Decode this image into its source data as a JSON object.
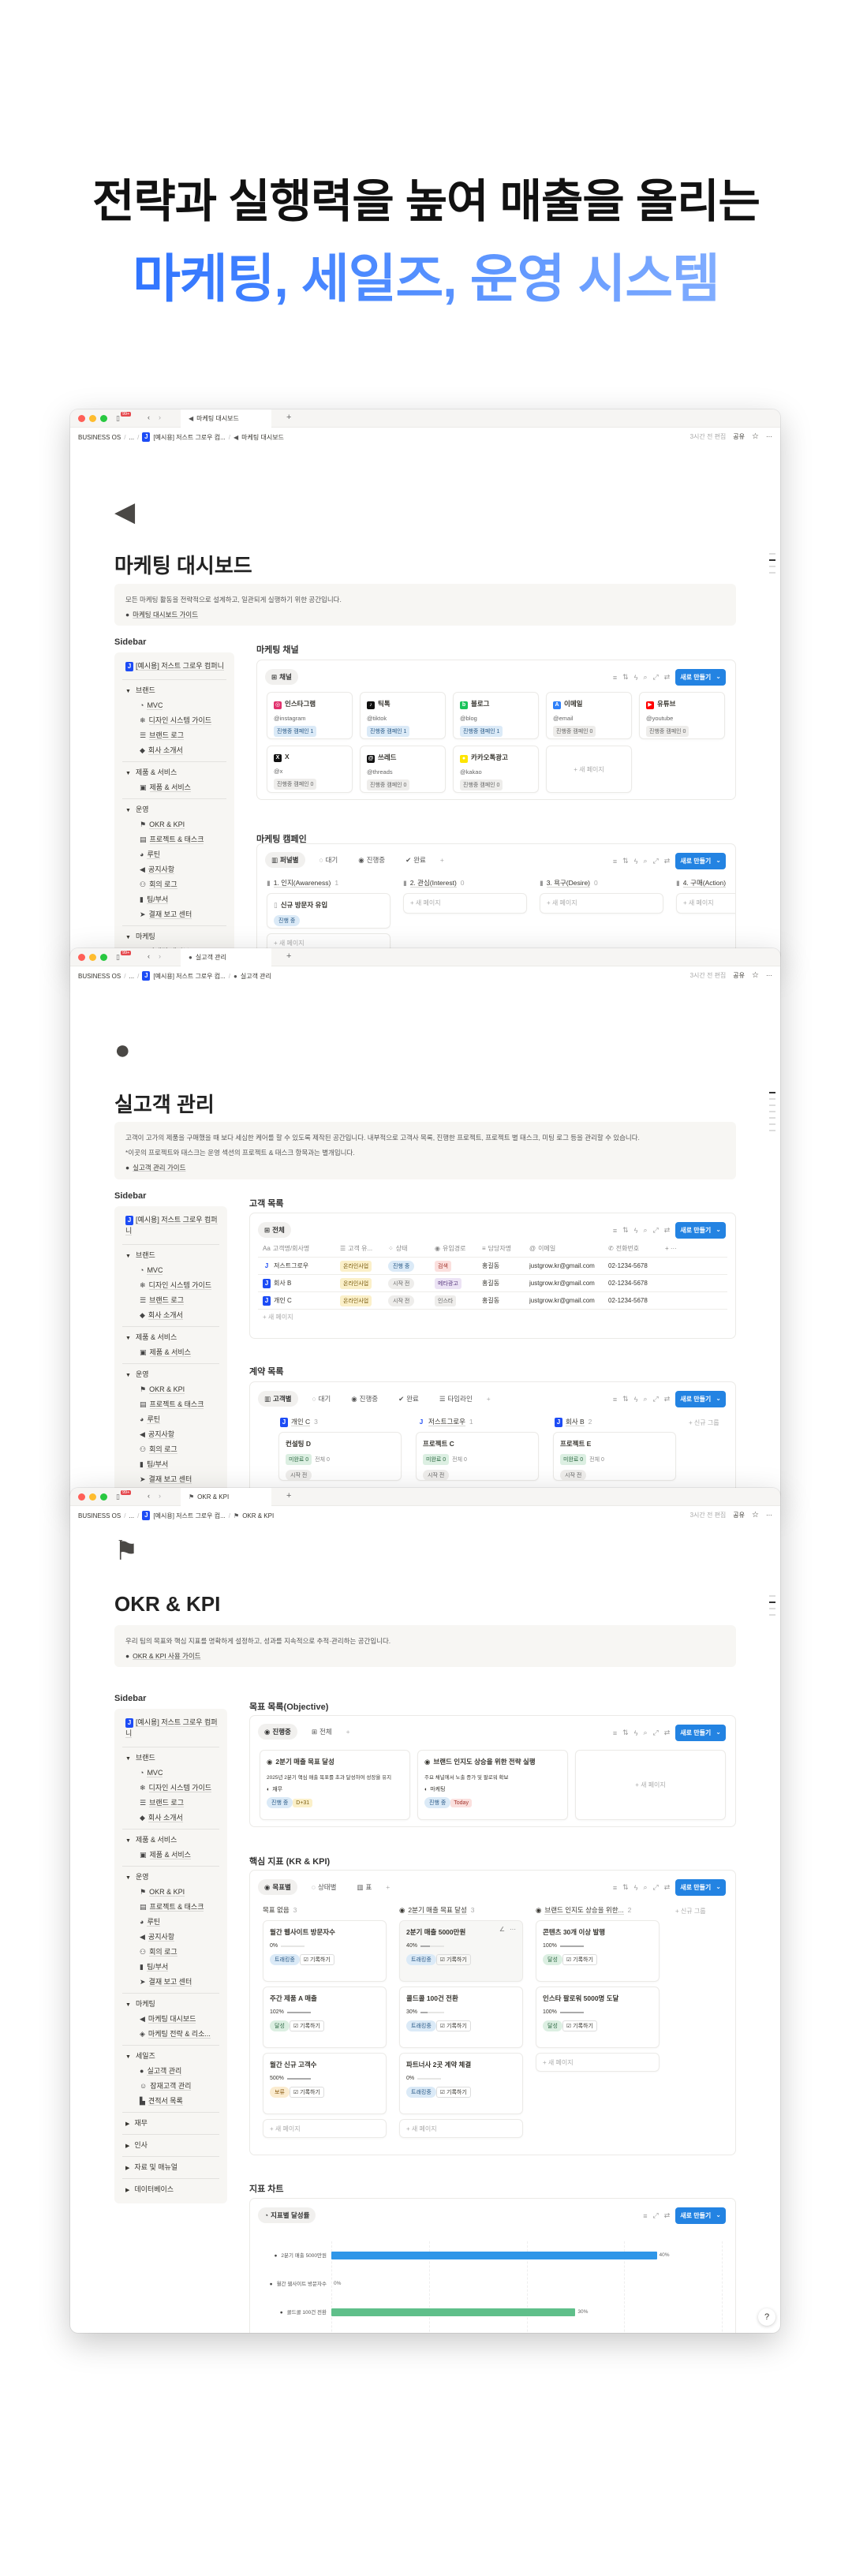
{
  "headline": {
    "line1": "전략과 실행력을 높여 매출을 올리는",
    "line2": "마케팅, 세일즈, 운영 시스템"
  },
  "browser": {
    "badge": "99+",
    "business_os": "BUSINESS OS",
    "ellipsis": "...",
    "workspace_logo": "J",
    "workspace_crumb": "[예시용] 저스트 그로우 컴...",
    "edited": "3시간 전 편집",
    "share": "공유",
    "new_tab": "+",
    "help": "?"
  },
  "sidebar": {
    "label": "Sidebar",
    "workspace": "[예시용] 저스트 그로우 컴퍼니",
    "groups": [
      {
        "title": "브랜드",
        "open": true,
        "items": [
          {
            "label": "MVC",
            "icon": "compass-icon"
          },
          {
            "label": "디자인 시스템 가이드",
            "icon": "snowflake-icon"
          },
          {
            "label": "브랜드 로그",
            "icon": "list-icon"
          },
          {
            "label": "회사 소개서",
            "icon": "speech-icon"
          }
        ]
      },
      {
        "title": "제품 & 서비스",
        "open": true,
        "items": [
          {
            "label": "제품 & 서비스",
            "icon": "gift-icon"
          }
        ]
      },
      {
        "title": "운영",
        "open": true,
        "items": [
          {
            "label": "OKR & KPI",
            "icon": "flag-icon"
          },
          {
            "label": "프로젝트 & 태스크",
            "icon": "id-card-icon"
          },
          {
            "label": "루틴",
            "icon": "clock-icon"
          },
          {
            "label": "공지사항",
            "icon": "megaphone-icon"
          },
          {
            "label": "회의 로그",
            "icon": "people-icon"
          },
          {
            "label": "팀/부서",
            "icon": "folder-icon"
          },
          {
            "label": "결재 보고 센터",
            "icon": "send-icon"
          }
        ]
      },
      {
        "title": "마케팅",
        "open": true,
        "items": [
          {
            "label": "마케팅 대시보드",
            "icon": "megaphone-icon"
          },
          {
            "label": "마케팅 전략 & 리소...",
            "icon": "diamond-icon"
          }
        ]
      },
      {
        "title": "세일즈",
        "open": true,
        "items": [
          {
            "label": "실고객 관리",
            "icon": "user-icon"
          },
          {
            "label": "잠재고객 관리",
            "icon": "smile-icon"
          },
          {
            "label": "견적서 목록",
            "icon": "document-icon"
          }
        ]
      },
      {
        "title": "재무",
        "open": false,
        "items": []
      },
      {
        "title": "인사",
        "open": false,
        "items": []
      },
      {
        "title": "자료 및 매뉴얼",
        "open": false,
        "items": []
      },
      {
        "title": "데이터베이스",
        "open": false,
        "items": []
      }
    ]
  },
  "pages": [
    {
      "tab": "마케팅 대시보드",
      "icon": "megaphone-icon",
      "title": "마케팅 대시보드",
      "desc": [
        "모든 마케팅 활동을 전략적으로 설계하고, 일관되게 실행하기 위한 공간입니다."
      ],
      "guide": "마케팅 대시보드 가이드",
      "channels": {
        "title": "마케팅 채널",
        "view": "채널",
        "new": "새로 만들기",
        "new_page": "+ 새 페이지",
        "items": [
          {
            "name": "인스타그램",
            "handle": "@instagram",
            "tag": "진행중 캠페인 1",
            "active": true,
            "icon": "instagram-icon",
            "color": "#e1306c"
          },
          {
            "name": "틱톡",
            "handle": "@tiktok",
            "tag": "진행중 캠페인 1",
            "active": true,
            "icon": "tiktok-icon",
            "color": "#111111"
          },
          {
            "name": "블로그",
            "handle": "@blog",
            "tag": "진행중 캠페인 1",
            "active": true,
            "icon": "blog-icon",
            "color": "#19c35a"
          },
          {
            "name": "이메일",
            "handle": "@email",
            "tag": "진행중 캠페인 0",
            "active": false,
            "icon": "email-icon",
            "color": "#2d7ff9"
          },
          {
            "name": "유튜브",
            "handle": "@youtube",
            "tag": "진행중 캠페인 0",
            "active": false,
            "icon": "youtube-icon",
            "color": "#ff0000"
          },
          {
            "name": "X",
            "handle": "@x",
            "tag": "진행중 캠페인 0",
            "active": false,
            "icon": "x-icon",
            "color": "#111111"
          },
          {
            "name": "쓰레드",
            "handle": "@threads",
            "tag": "진행중 캠페인 0",
            "active": false,
            "icon": "threads-icon",
            "color": "#111111"
          },
          {
            "name": "카카오톡광고",
            "handle": "@kakao",
            "tag": "진행중 캠페인 0",
            "active": false,
            "icon": "kakao-icon",
            "color": "#fee500"
          }
        ]
      },
      "campaigns": {
        "title": "마케팅 캠페인",
        "tabs": [
          "퍼널별",
          "대기",
          "진행중",
          "완료"
        ],
        "new": "새로 만들기",
        "columns": [
          {
            "name": "1. 인지(Awareness)",
            "count": "1"
          },
          {
            "name": "2. 관심(Interest)",
            "count": "0"
          },
          {
            "name": "3. 욕구(Desire)",
            "count": "0"
          },
          {
            "name": "4. 구매(Action)",
            "count": ""
          }
        ],
        "card": {
          "title": "신규 방문자 유입",
          "status": "진행 중"
        },
        "new_page": "+ 새 페이지"
      }
    },
    {
      "tab": "실고객 관리",
      "icon": "user-icon",
      "title": "실고객 관리",
      "desc": [
        "고객이 고가의 제품을 구매했을 때 보다 세심한 케어를 할 수 있도록 제작된 공간입니다. 내부적으로 고객사 목록, 진행한 프로젝트, 프로젝트 별 태스크, 미팅 로그 등을 관리할 수 있습니다.",
        "*이곳의 프로젝트와 태스크는 운영 섹션의 프로젝트 & 태스크 항목과는 별개입니다."
      ],
      "guide": "실고객 관리 가이드",
      "customers": {
        "title": "고객 목록",
        "view": "전체",
        "new": "새로 만들기",
        "headers": [
          "고객명/회사명",
          "고객 유...",
          "상태",
          "유입경로",
          "담당자명",
          "이메일",
          "전화번호"
        ],
        "rows": [
          [
            "저스트그로우",
            "온라인사업",
            "진행 중",
            "검색",
            "홍길동",
            "justgrow.kr@gmail.com",
            "02-1234-5678"
          ],
          [
            "회사 B",
            "온라인사업",
            "시작 전",
            "메타광고",
            "홍길동",
            "justgrow.kr@gmail.com",
            "02-1234-5678"
          ],
          [
            "개인 C",
            "온라인사업",
            "시작 전",
            "인스타",
            "홍길동",
            "justgrow.kr@gmail.com",
            "02-1234-5678"
          ]
        ],
        "new_page": "+ 새 페이지"
      },
      "contracts": {
        "title": "계약 목록",
        "tabs": [
          "고객별",
          "대기",
          "진행중",
          "완료",
          "타임라인"
        ],
        "new": "새로 만들기",
        "new_group": "+ 신규 그룹",
        "groups": [
          {
            "name": "개인 C",
            "count": "3",
            "card": "컨설팅 D"
          },
          {
            "name": "저스트그로우",
            "count": "1",
            "card": "프로젝트 C"
          },
          {
            "name": "회사 B",
            "count": "2",
            "card": "프로젝트 E"
          }
        ],
        "tag_incomplete": "미완료 0",
        "tag_total": "전체 0",
        "status": "시작 전"
      }
    },
    {
      "tab": "OKR & KPI",
      "icon": "flag-icon",
      "title": "OKR & KPI",
      "desc": [
        "우리 팀의 목표와 핵심 지표를 명확하게 설정하고, 성과를 지속적으로 추적·관리하는 공간입니다."
      ],
      "guide": "OKR & KPI 사용 가이드",
      "objectives": {
        "title": "목표 목록(Objective)",
        "tabs": [
          "진행중",
          "전체"
        ],
        "new": "새로 만들기",
        "new_page": "+ 새 페이지",
        "items": [
          {
            "title": "2분기 매출 목표 달성",
            "desc": "2025년 2분기 핵심 매출 목표를 초과 달성하여 성장을 유지",
            "dept": "재무",
            "status": "진행 중",
            "date": "D+31",
            "date_color": "yellow"
          },
          {
            "title": "브랜드 인지도 상승을 위한 전략 실행",
            "desc": "주요 채널에서 노출 증가 및 팔로워 확보",
            "dept": "마케팅",
            "status": "진행 중",
            "date": "Today",
            "date_color": "red"
          }
        ]
      },
      "krs": {
        "title": "핵심 지표 (KR & KPI)",
        "tabs": [
          "목표별",
          "상태별",
          "표"
        ],
        "new": "새로 만들기",
        "new_group": "+ 신규 그룹",
        "record": "기록하기",
        "new_page": "+ 새 페이지",
        "groups": [
          {
            "name": "목표 없음",
            "count": "3",
            "items": [
              {
                "title": "월간 웹사이트 방문자수",
                "progress": 0,
                "label": "0%",
                "status": "트래킹중",
                "color": "blue"
              },
              {
                "title": "주간 제품 A 매출",
                "progress": 102,
                "label": "102%",
                "status": "달성",
                "color": "green"
              },
              {
                "title": "월간 신규 고객수",
                "progress": 500,
                "label": "500%",
                "status": "보류",
                "color": "orange"
              }
            ]
          },
          {
            "name": "2분기 매출 목표 달성",
            "count": "3",
            "items": [
              {
                "title": "2분기 매출 5000만원",
                "progress": 40,
                "label": "40%",
                "status": "트래킹중",
                "color": "blue"
              },
              {
                "title": "콜드콜 100건 전환",
                "progress": 30,
                "label": "30%",
                "status": "트래킹중",
                "color": "blue"
              },
              {
                "title": "파트너사 2곳 계약 체결",
                "progress": 0,
                "label": "0%",
                "status": "트래킹중",
                "color": "blue"
              }
            ]
          },
          {
            "name": "브랜드 인지도 상승을 위한...",
            "count": "2",
            "items": [
              {
                "title": "콘텐츠 30개 이상 발행",
                "progress": 100,
                "label": "100%",
                "status": "달성",
                "color": "green"
              },
              {
                "title": "인스타 팔로워 5000명 도달",
                "progress": 100,
                "label": "100%",
                "status": "달성",
                "color": "green"
              }
            ]
          }
        ]
      },
      "chart_section": {
        "title": "지표 차트",
        "view": "지표별 달성률",
        "new": "새로 만들기"
      }
    }
  ],
  "chart_data": {
    "type": "bar",
    "orientation": "horizontal",
    "title": "지표별 달성률",
    "categories": [
      "2분기 매출 5000만원",
      "월간 웹사이트 방문자수",
      "콜드콜 100건 전환"
    ],
    "values": [
      40,
      0,
      30
    ],
    "labels": [
      "40%",
      "0%",
      "30%"
    ],
    "colors": [
      "#2f96e8",
      "#2f96e8",
      "#5fbf8a"
    ],
    "xlim": [
      0,
      48
    ],
    "grid": true
  }
}
